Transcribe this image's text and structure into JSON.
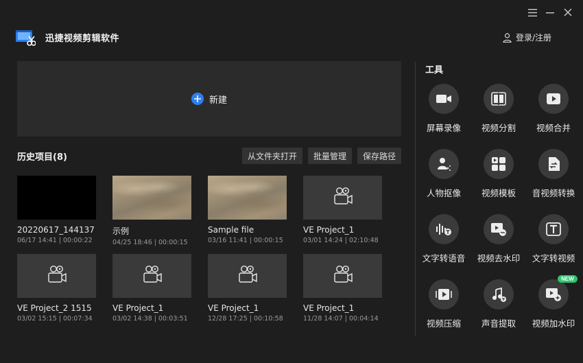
{
  "app": {
    "title": "迅捷视频剪辑软件",
    "login_label": "登录/注册"
  },
  "new_project": {
    "label": "新建"
  },
  "history": {
    "title": "历史项目(8)",
    "buttons": [
      "从文件夹打开",
      "批量管理",
      "保存路径"
    ],
    "projects": [
      {
        "name": "20220617_144137",
        "meta": "06/17 14:41 | 00:00:22",
        "thumb": "black"
      },
      {
        "name": "示例",
        "meta": "04/25 18:46 | 00:00:15",
        "thumb": "sand"
      },
      {
        "name": "Sample file",
        "meta": "03/16 11:41 | 00:00:15",
        "thumb": "sand"
      },
      {
        "name": "VE Project_1",
        "meta": "03/01 14:24 | 02:10:48",
        "thumb": "camera"
      },
      {
        "name": "VE Project_2 1515",
        "meta": "03/02 15:15 | 00:07:34",
        "thumb": "camera"
      },
      {
        "name": "VE Project_1",
        "meta": "03/02 14:38 | 00:03:51",
        "thumb": "camera"
      },
      {
        "name": "VE Project_1",
        "meta": "12/28 17:25 | 00:10:58",
        "thumb": "camera"
      },
      {
        "name": "VE Project_1",
        "meta": "11/28 14:07 | 00:04:14",
        "thumb": "camera"
      }
    ]
  },
  "tools": {
    "title": "工具",
    "items": [
      {
        "label": "屏幕录像",
        "icon": "screen-record-icon"
      },
      {
        "label": "视频分割",
        "icon": "video-split-icon"
      },
      {
        "label": "视频合并",
        "icon": "video-merge-icon"
      },
      {
        "label": "人物抠像",
        "icon": "portrait-cutout-icon"
      },
      {
        "label": "视频模板",
        "icon": "video-template-icon"
      },
      {
        "label": "音视频转换",
        "icon": "av-convert-icon"
      },
      {
        "label": "文字转语音",
        "icon": "text-to-speech-icon"
      },
      {
        "label": "视频去水印",
        "icon": "remove-watermark-icon"
      },
      {
        "label": "文字转视频",
        "icon": "text-to-video-icon"
      },
      {
        "label": "视频压缩",
        "icon": "video-compress-icon"
      },
      {
        "label": "声音提取",
        "icon": "audio-extract-icon"
      },
      {
        "label": "视频加水印",
        "icon": "add-watermark-icon",
        "badge": "NEW"
      }
    ]
  },
  "colors": {
    "accent": "#2d7ff0",
    "badge": "#2cc56f",
    "background": "#1e1e1e"
  }
}
